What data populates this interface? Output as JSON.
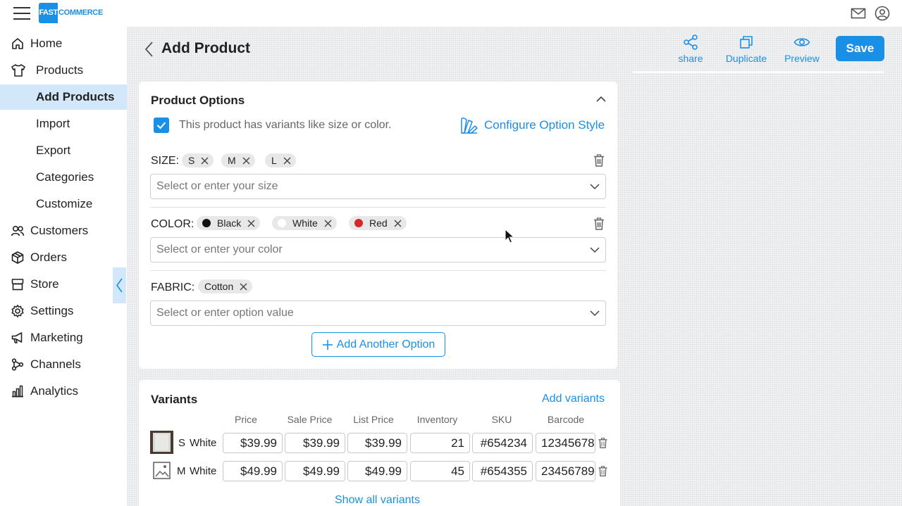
{
  "app": {
    "logo_fast": "FAST",
    "logo_commerce": "COMMERCE"
  },
  "sidebar": {
    "items": [
      {
        "label": "Home",
        "icon": "home-icon"
      },
      {
        "label": "Products",
        "icon": "shirt-icon"
      },
      {
        "label": "Add Products",
        "active": true
      },
      {
        "label": "Import"
      },
      {
        "label": "Export"
      },
      {
        "label": "Categories"
      },
      {
        "label": "Customize"
      },
      {
        "label": "Customers",
        "icon": "users-icon"
      },
      {
        "label": "Orders",
        "icon": "box-icon"
      },
      {
        "label": "Store",
        "icon": "store-icon"
      },
      {
        "label": "Settings",
        "icon": "gear-icon"
      },
      {
        "label": "Marketing",
        "icon": "megaphone-icon"
      },
      {
        "label": "Channels",
        "icon": "channels-icon"
      },
      {
        "label": "Analytics",
        "icon": "analytics-icon"
      }
    ]
  },
  "header": {
    "title": "Add Product",
    "actions": {
      "share": "share",
      "duplicate": "Duplicate",
      "preview": "Preview",
      "save": "Save"
    }
  },
  "product_options": {
    "title": "Product Options",
    "variants_checkbox_label": "This product has variants like size or color.",
    "variants_checked": true,
    "configure_link": "Configure Option Style",
    "options": [
      {
        "label": "SIZE:",
        "values": [
          {
            "label": "S"
          },
          {
            "label": "M"
          },
          {
            "label": "L"
          }
        ],
        "placeholder": "Select or enter your size"
      },
      {
        "label": "COLOR:",
        "values": [
          {
            "label": "Black",
            "swatch": "#111111"
          },
          {
            "label": "White",
            "swatch": "#ffffff"
          },
          {
            "label": "Red",
            "swatch": "#d9262a"
          }
        ],
        "placeholder": "Select or enter your color"
      },
      {
        "label": "FABRIC:",
        "values": [
          {
            "label": "Cotton"
          }
        ],
        "placeholder": "Select or enter option value"
      }
    ],
    "add_option_label": "Add Another Option"
  },
  "variants": {
    "title": "Variants",
    "add_link": "Add variants",
    "columns": [
      "Price",
      "Sale Price",
      "List Price",
      "Inventory",
      "SKU",
      "Barcode"
    ],
    "rows": [
      {
        "size": "S",
        "color": "White",
        "price": "$39.99",
        "sale_price": "$39.99",
        "list_price": "$39.99",
        "inventory": "21",
        "sku": "#654234",
        "barcode": "12345678"
      },
      {
        "size": "M",
        "color": "White",
        "price": "$49.99",
        "sale_price": "$49.99",
        "list_price": "$49.99",
        "inventory": "45",
        "sku": "#654355",
        "barcode": "23456789"
      }
    ],
    "show_all": "Show all variants"
  },
  "colors": {
    "accent": "#1a8fe6",
    "active_nav_bg": "#d2e7fa"
  }
}
